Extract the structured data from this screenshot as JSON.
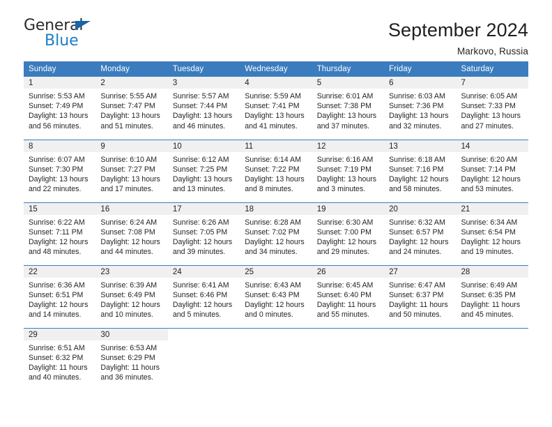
{
  "logo": {
    "word_top": "General",
    "word_bottom": "Blue",
    "triangle_icon": "triangle-icon",
    "brand_blue": "#1b7fc4",
    "brand_dark_blue": "#1565a8"
  },
  "header": {
    "title": "September 2024",
    "subtitle": "Markovo, Russia"
  },
  "theme": {
    "header_row_bg": "#3a7cbe",
    "daynum_band_bg": "#f0f0f0",
    "text": "#242424"
  },
  "weekday_headers": [
    "Sunday",
    "Monday",
    "Tuesday",
    "Wednesday",
    "Thursday",
    "Friday",
    "Saturday"
  ],
  "weeks": [
    [
      {
        "day": "1",
        "sunrise": "Sunrise: 5:53 AM",
        "sunset": "Sunset: 7:49 PM",
        "daylight_line1": "Daylight: 13 hours",
        "daylight_line2": "and 56 minutes."
      },
      {
        "day": "2",
        "sunrise": "Sunrise: 5:55 AM",
        "sunset": "Sunset: 7:47 PM",
        "daylight_line1": "Daylight: 13 hours",
        "daylight_line2": "and 51 minutes."
      },
      {
        "day": "3",
        "sunrise": "Sunrise: 5:57 AM",
        "sunset": "Sunset: 7:44 PM",
        "daylight_line1": "Daylight: 13 hours",
        "daylight_line2": "and 46 minutes."
      },
      {
        "day": "4",
        "sunrise": "Sunrise: 5:59 AM",
        "sunset": "Sunset: 7:41 PM",
        "daylight_line1": "Daylight: 13 hours",
        "daylight_line2": "and 41 minutes."
      },
      {
        "day": "5",
        "sunrise": "Sunrise: 6:01 AM",
        "sunset": "Sunset: 7:38 PM",
        "daylight_line1": "Daylight: 13 hours",
        "daylight_line2": "and 37 minutes."
      },
      {
        "day": "6",
        "sunrise": "Sunrise: 6:03 AM",
        "sunset": "Sunset: 7:36 PM",
        "daylight_line1": "Daylight: 13 hours",
        "daylight_line2": "and 32 minutes."
      },
      {
        "day": "7",
        "sunrise": "Sunrise: 6:05 AM",
        "sunset": "Sunset: 7:33 PM",
        "daylight_line1": "Daylight: 13 hours",
        "daylight_line2": "and 27 minutes."
      }
    ],
    [
      {
        "day": "8",
        "sunrise": "Sunrise: 6:07 AM",
        "sunset": "Sunset: 7:30 PM",
        "daylight_line1": "Daylight: 13 hours",
        "daylight_line2": "and 22 minutes."
      },
      {
        "day": "9",
        "sunrise": "Sunrise: 6:10 AM",
        "sunset": "Sunset: 7:27 PM",
        "daylight_line1": "Daylight: 13 hours",
        "daylight_line2": "and 17 minutes."
      },
      {
        "day": "10",
        "sunrise": "Sunrise: 6:12 AM",
        "sunset": "Sunset: 7:25 PM",
        "daylight_line1": "Daylight: 13 hours",
        "daylight_line2": "and 13 minutes."
      },
      {
        "day": "11",
        "sunrise": "Sunrise: 6:14 AM",
        "sunset": "Sunset: 7:22 PM",
        "daylight_line1": "Daylight: 13 hours",
        "daylight_line2": "and 8 minutes."
      },
      {
        "day": "12",
        "sunrise": "Sunrise: 6:16 AM",
        "sunset": "Sunset: 7:19 PM",
        "daylight_line1": "Daylight: 13 hours",
        "daylight_line2": "and 3 minutes."
      },
      {
        "day": "13",
        "sunrise": "Sunrise: 6:18 AM",
        "sunset": "Sunset: 7:16 PM",
        "daylight_line1": "Daylight: 12 hours",
        "daylight_line2": "and 58 minutes."
      },
      {
        "day": "14",
        "sunrise": "Sunrise: 6:20 AM",
        "sunset": "Sunset: 7:14 PM",
        "daylight_line1": "Daylight: 12 hours",
        "daylight_line2": "and 53 minutes."
      }
    ],
    [
      {
        "day": "15",
        "sunrise": "Sunrise: 6:22 AM",
        "sunset": "Sunset: 7:11 PM",
        "daylight_line1": "Daylight: 12 hours",
        "daylight_line2": "and 48 minutes."
      },
      {
        "day": "16",
        "sunrise": "Sunrise: 6:24 AM",
        "sunset": "Sunset: 7:08 PM",
        "daylight_line1": "Daylight: 12 hours",
        "daylight_line2": "and 44 minutes."
      },
      {
        "day": "17",
        "sunrise": "Sunrise: 6:26 AM",
        "sunset": "Sunset: 7:05 PM",
        "daylight_line1": "Daylight: 12 hours",
        "daylight_line2": "and 39 minutes."
      },
      {
        "day": "18",
        "sunrise": "Sunrise: 6:28 AM",
        "sunset": "Sunset: 7:02 PM",
        "daylight_line1": "Daylight: 12 hours",
        "daylight_line2": "and 34 minutes."
      },
      {
        "day": "19",
        "sunrise": "Sunrise: 6:30 AM",
        "sunset": "Sunset: 7:00 PM",
        "daylight_line1": "Daylight: 12 hours",
        "daylight_line2": "and 29 minutes."
      },
      {
        "day": "20",
        "sunrise": "Sunrise: 6:32 AM",
        "sunset": "Sunset: 6:57 PM",
        "daylight_line1": "Daylight: 12 hours",
        "daylight_line2": "and 24 minutes."
      },
      {
        "day": "21",
        "sunrise": "Sunrise: 6:34 AM",
        "sunset": "Sunset: 6:54 PM",
        "daylight_line1": "Daylight: 12 hours",
        "daylight_line2": "and 19 minutes."
      }
    ],
    [
      {
        "day": "22",
        "sunrise": "Sunrise: 6:36 AM",
        "sunset": "Sunset: 6:51 PM",
        "daylight_line1": "Daylight: 12 hours",
        "daylight_line2": "and 14 minutes."
      },
      {
        "day": "23",
        "sunrise": "Sunrise: 6:39 AM",
        "sunset": "Sunset: 6:49 PM",
        "daylight_line1": "Daylight: 12 hours",
        "daylight_line2": "and 10 minutes."
      },
      {
        "day": "24",
        "sunrise": "Sunrise: 6:41 AM",
        "sunset": "Sunset: 6:46 PM",
        "daylight_line1": "Daylight: 12 hours",
        "daylight_line2": "and 5 minutes."
      },
      {
        "day": "25",
        "sunrise": "Sunrise: 6:43 AM",
        "sunset": "Sunset: 6:43 PM",
        "daylight_line1": "Daylight: 12 hours",
        "daylight_line2": "and 0 minutes."
      },
      {
        "day": "26",
        "sunrise": "Sunrise: 6:45 AM",
        "sunset": "Sunset: 6:40 PM",
        "daylight_line1": "Daylight: 11 hours",
        "daylight_line2": "and 55 minutes."
      },
      {
        "day": "27",
        "sunrise": "Sunrise: 6:47 AM",
        "sunset": "Sunset: 6:37 PM",
        "daylight_line1": "Daylight: 11 hours",
        "daylight_line2": "and 50 minutes."
      },
      {
        "day": "28",
        "sunrise": "Sunrise: 6:49 AM",
        "sunset": "Sunset: 6:35 PM",
        "daylight_line1": "Daylight: 11 hours",
        "daylight_line2": "and 45 minutes."
      }
    ],
    [
      {
        "day": "29",
        "sunrise": "Sunrise: 6:51 AM",
        "sunset": "Sunset: 6:32 PM",
        "daylight_line1": "Daylight: 11 hours",
        "daylight_line2": "and 40 minutes."
      },
      {
        "day": "30",
        "sunrise": "Sunrise: 6:53 AM",
        "sunset": "Sunset: 6:29 PM",
        "daylight_line1": "Daylight: 11 hours",
        "daylight_line2": "and 36 minutes."
      },
      {
        "day": "",
        "sunrise": "",
        "sunset": "",
        "daylight_line1": "",
        "daylight_line2": ""
      },
      {
        "day": "",
        "sunrise": "",
        "sunset": "",
        "daylight_line1": "",
        "daylight_line2": ""
      },
      {
        "day": "",
        "sunrise": "",
        "sunset": "",
        "daylight_line1": "",
        "daylight_line2": ""
      },
      {
        "day": "",
        "sunrise": "",
        "sunset": "",
        "daylight_line1": "",
        "daylight_line2": ""
      },
      {
        "day": "",
        "sunrise": "",
        "sunset": "",
        "daylight_line1": "",
        "daylight_line2": ""
      }
    ]
  ]
}
